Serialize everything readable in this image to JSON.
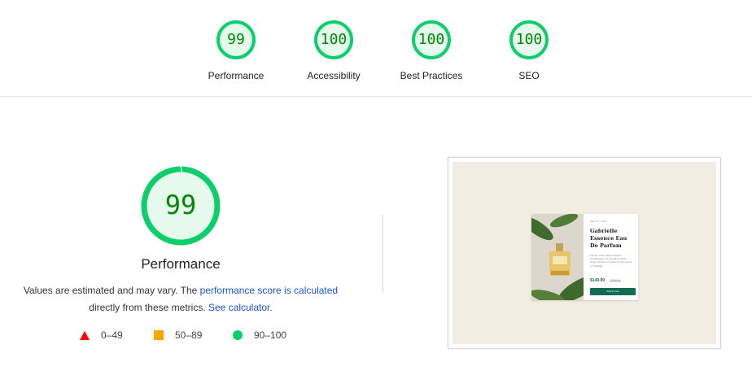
{
  "summary": {
    "gauges": [
      {
        "score": "99",
        "label": "Performance"
      },
      {
        "score": "100",
        "label": "Accessibility"
      },
      {
        "score": "100",
        "label": "Best Practices"
      },
      {
        "score": "100",
        "label": "SEO"
      }
    ]
  },
  "performance": {
    "score": "99",
    "title": "Performance",
    "desc_prefix": "Values are estimated and may vary. The ",
    "desc_link1": "performance score is calculated",
    "desc_middle": " directly from these metrics. ",
    "desc_link2": "See calculator."
  },
  "legend": {
    "fail": "0–49",
    "average": "50–89",
    "pass": "90–100"
  },
  "colors": {
    "pass": "#0cce6b",
    "pass_text": "#008800",
    "pass_fill": "#e6f9ed",
    "average": "#ffa400",
    "fail": "#ff0000",
    "link": "#1a55d3"
  },
  "preview": {
    "kicker": "NEW IN · 2024",
    "product_title": "Gabrielle Essence Eau De Parfum",
    "product_text": "A floral, solar and sumptuous interpretation composed by Olivier Polge, Perfumer-Creator for the House of CHANEL.",
    "price": "$149.99",
    "old_price": "$189.99",
    "button": "Add to Cart"
  }
}
